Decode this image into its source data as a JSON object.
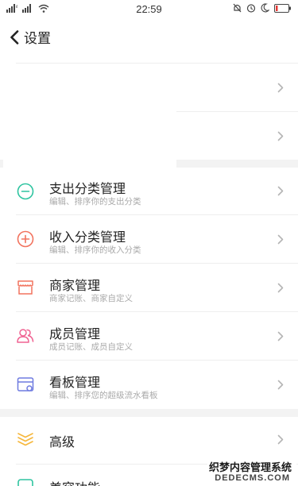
{
  "status_bar": {
    "signal_1": "signal-icon",
    "signal_2": "signal-icon",
    "wifi": "wifi-icon",
    "time": "22:59",
    "right_icons": [
      "mute-icon",
      "alarm-icon",
      "moon-icon",
      "battery-icon"
    ]
  },
  "nav": {
    "back_icon": "chevron-left-icon",
    "title": "设置"
  },
  "blank_rows": [
    {
      "chevron_icon": "chevron-right-icon"
    },
    {
      "chevron_icon": "chevron-right-icon"
    }
  ],
  "rows": [
    {
      "title": "支出分类管理",
      "subtitle": "编辑、排序你的支出分类",
      "icon": "minus-circle-icon",
      "color": "#2ec4a0"
    },
    {
      "title": "收入分类管理",
      "subtitle": "编辑、排序你的收入分类",
      "icon": "plus-circle-icon",
      "color": "#f2735e"
    },
    {
      "title": "商家管理",
      "subtitle": "商家记账、商家自定义",
      "icon": "store-icon",
      "color": "#f2735e"
    },
    {
      "title": "成员管理",
      "subtitle": "成员记账、成员自定义",
      "icon": "members-icon",
      "color": "#f06292"
    },
    {
      "title": "看板管理",
      "subtitle": "编辑、排序您的超级流水看板",
      "icon": "board-icon",
      "color": "#6f7be0"
    }
  ],
  "advanced": {
    "title": "高级",
    "icon": "layers-icon",
    "color": "#f6b73c"
  },
  "partial_row": {
    "title": "美容功能",
    "icon": "partial-icon",
    "color": "#2ec4a0"
  },
  "watermark": {
    "line1": "织梦内容管理系统",
    "line2": "DEDECMS.COM"
  }
}
